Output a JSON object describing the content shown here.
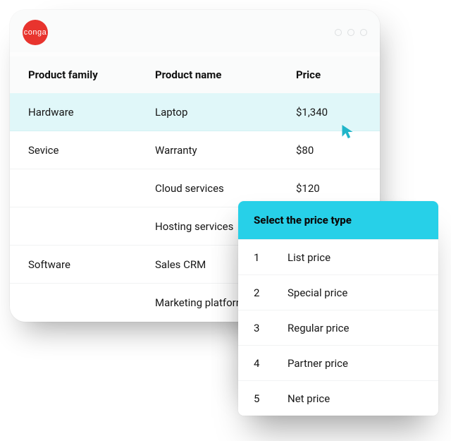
{
  "brand": {
    "name": "conga",
    "color": "#e8342e"
  },
  "table": {
    "columns": [
      "Product family",
      "Product name",
      "Price"
    ],
    "rows": [
      {
        "family": "Hardware",
        "name": "Laptop",
        "price": "$1,340",
        "highlight": true
      },
      {
        "family": "Sevice",
        "name": "Warranty",
        "price": "$80",
        "highlight": false
      },
      {
        "family": "",
        "name": "Cloud services",
        "price": "$120",
        "highlight": false
      },
      {
        "family": "",
        "name": "Hosting services",
        "price": "",
        "highlight": false
      },
      {
        "family": "Software",
        "name": "Sales CRM",
        "price": "",
        "highlight": false
      },
      {
        "family": "",
        "name": "Marketing platform",
        "price": "",
        "highlight": false
      }
    ]
  },
  "popup": {
    "title": "Select the price type",
    "accent": "#27d0e8",
    "items": [
      {
        "index": "1",
        "label": "List price"
      },
      {
        "index": "2",
        "label": "Special price"
      },
      {
        "index": "3",
        "label": "Regular price"
      },
      {
        "index": "4",
        "label": "Partner price"
      },
      {
        "index": "5",
        "label": "Net price"
      }
    ]
  },
  "cursor_color": "#20b5c9"
}
